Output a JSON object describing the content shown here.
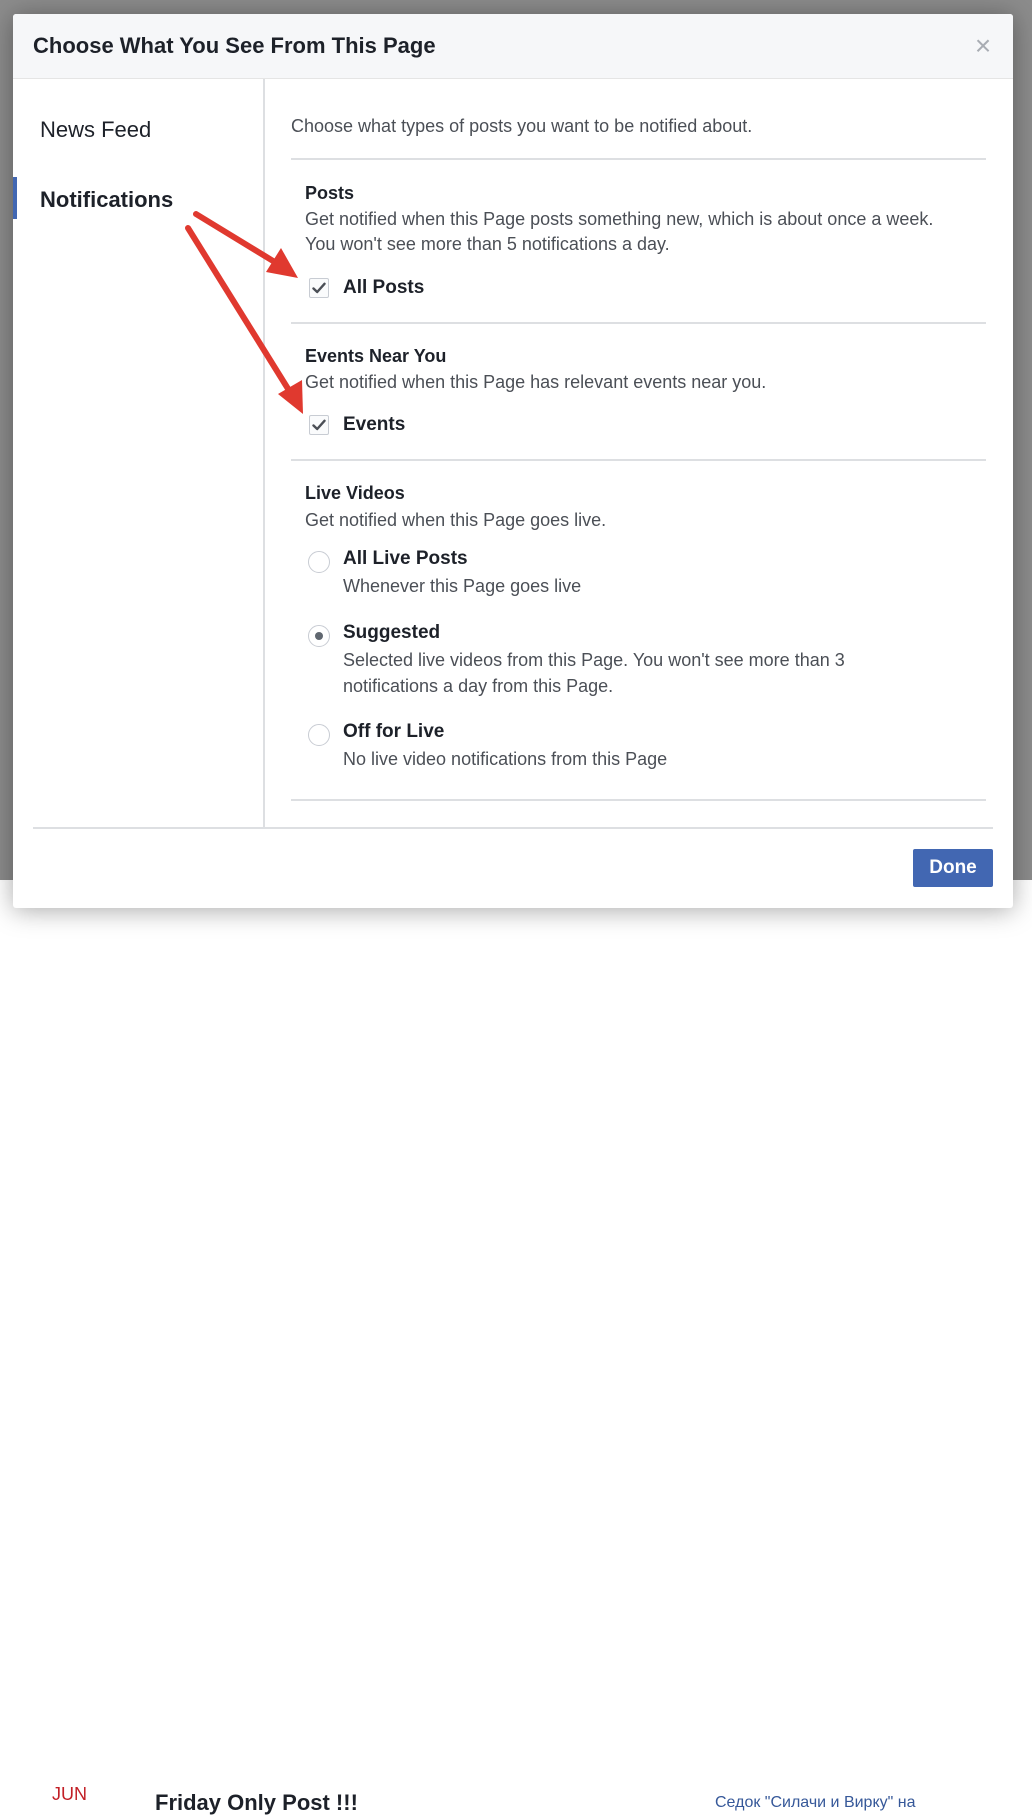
{
  "background": {
    "month": "JUN",
    "event_title": "Friday Only Post !!!",
    "event_link": "Седок \"Силачи и Вирку\" на"
  },
  "dialog": {
    "title": "Choose What You See From This Page",
    "close_glyph": "×"
  },
  "sidebar": {
    "items": [
      {
        "label": "News Feed",
        "active": false
      },
      {
        "label": "Notifications",
        "active": true
      }
    ]
  },
  "content": {
    "intro": "Choose what types of posts you want to be notified about.",
    "sections": [
      {
        "title": "Posts",
        "description": "Get notified when this Page posts something new, which is about once a week. You won't see more than 5 notifications a day.",
        "checkbox": {
          "label": "All Posts",
          "checked": true
        }
      },
      {
        "title": "Events Near You",
        "description": "Get notified when this Page has relevant events near you.",
        "checkbox": {
          "label": "Events",
          "checked": true
        }
      },
      {
        "title": "Live Videos",
        "description": "Get notified when this Page goes live.",
        "options": [
          {
            "title": "All Live Posts",
            "description": "Whenever this Page goes live",
            "selected": false
          },
          {
            "title": "Suggested",
            "description": "Selected live videos from this Page. You won't see more than 3 notifications a day from this Page.",
            "selected": true
          },
          {
            "title": "Off for Live",
            "description": "No live video notifications from this Page",
            "selected": false
          }
        ]
      }
    ]
  },
  "footer": {
    "done_label": "Done"
  },
  "colors": {
    "accent": "#4267b2",
    "annotation_arrow": "#e0392f",
    "overlay": "#8c8c8c"
  }
}
